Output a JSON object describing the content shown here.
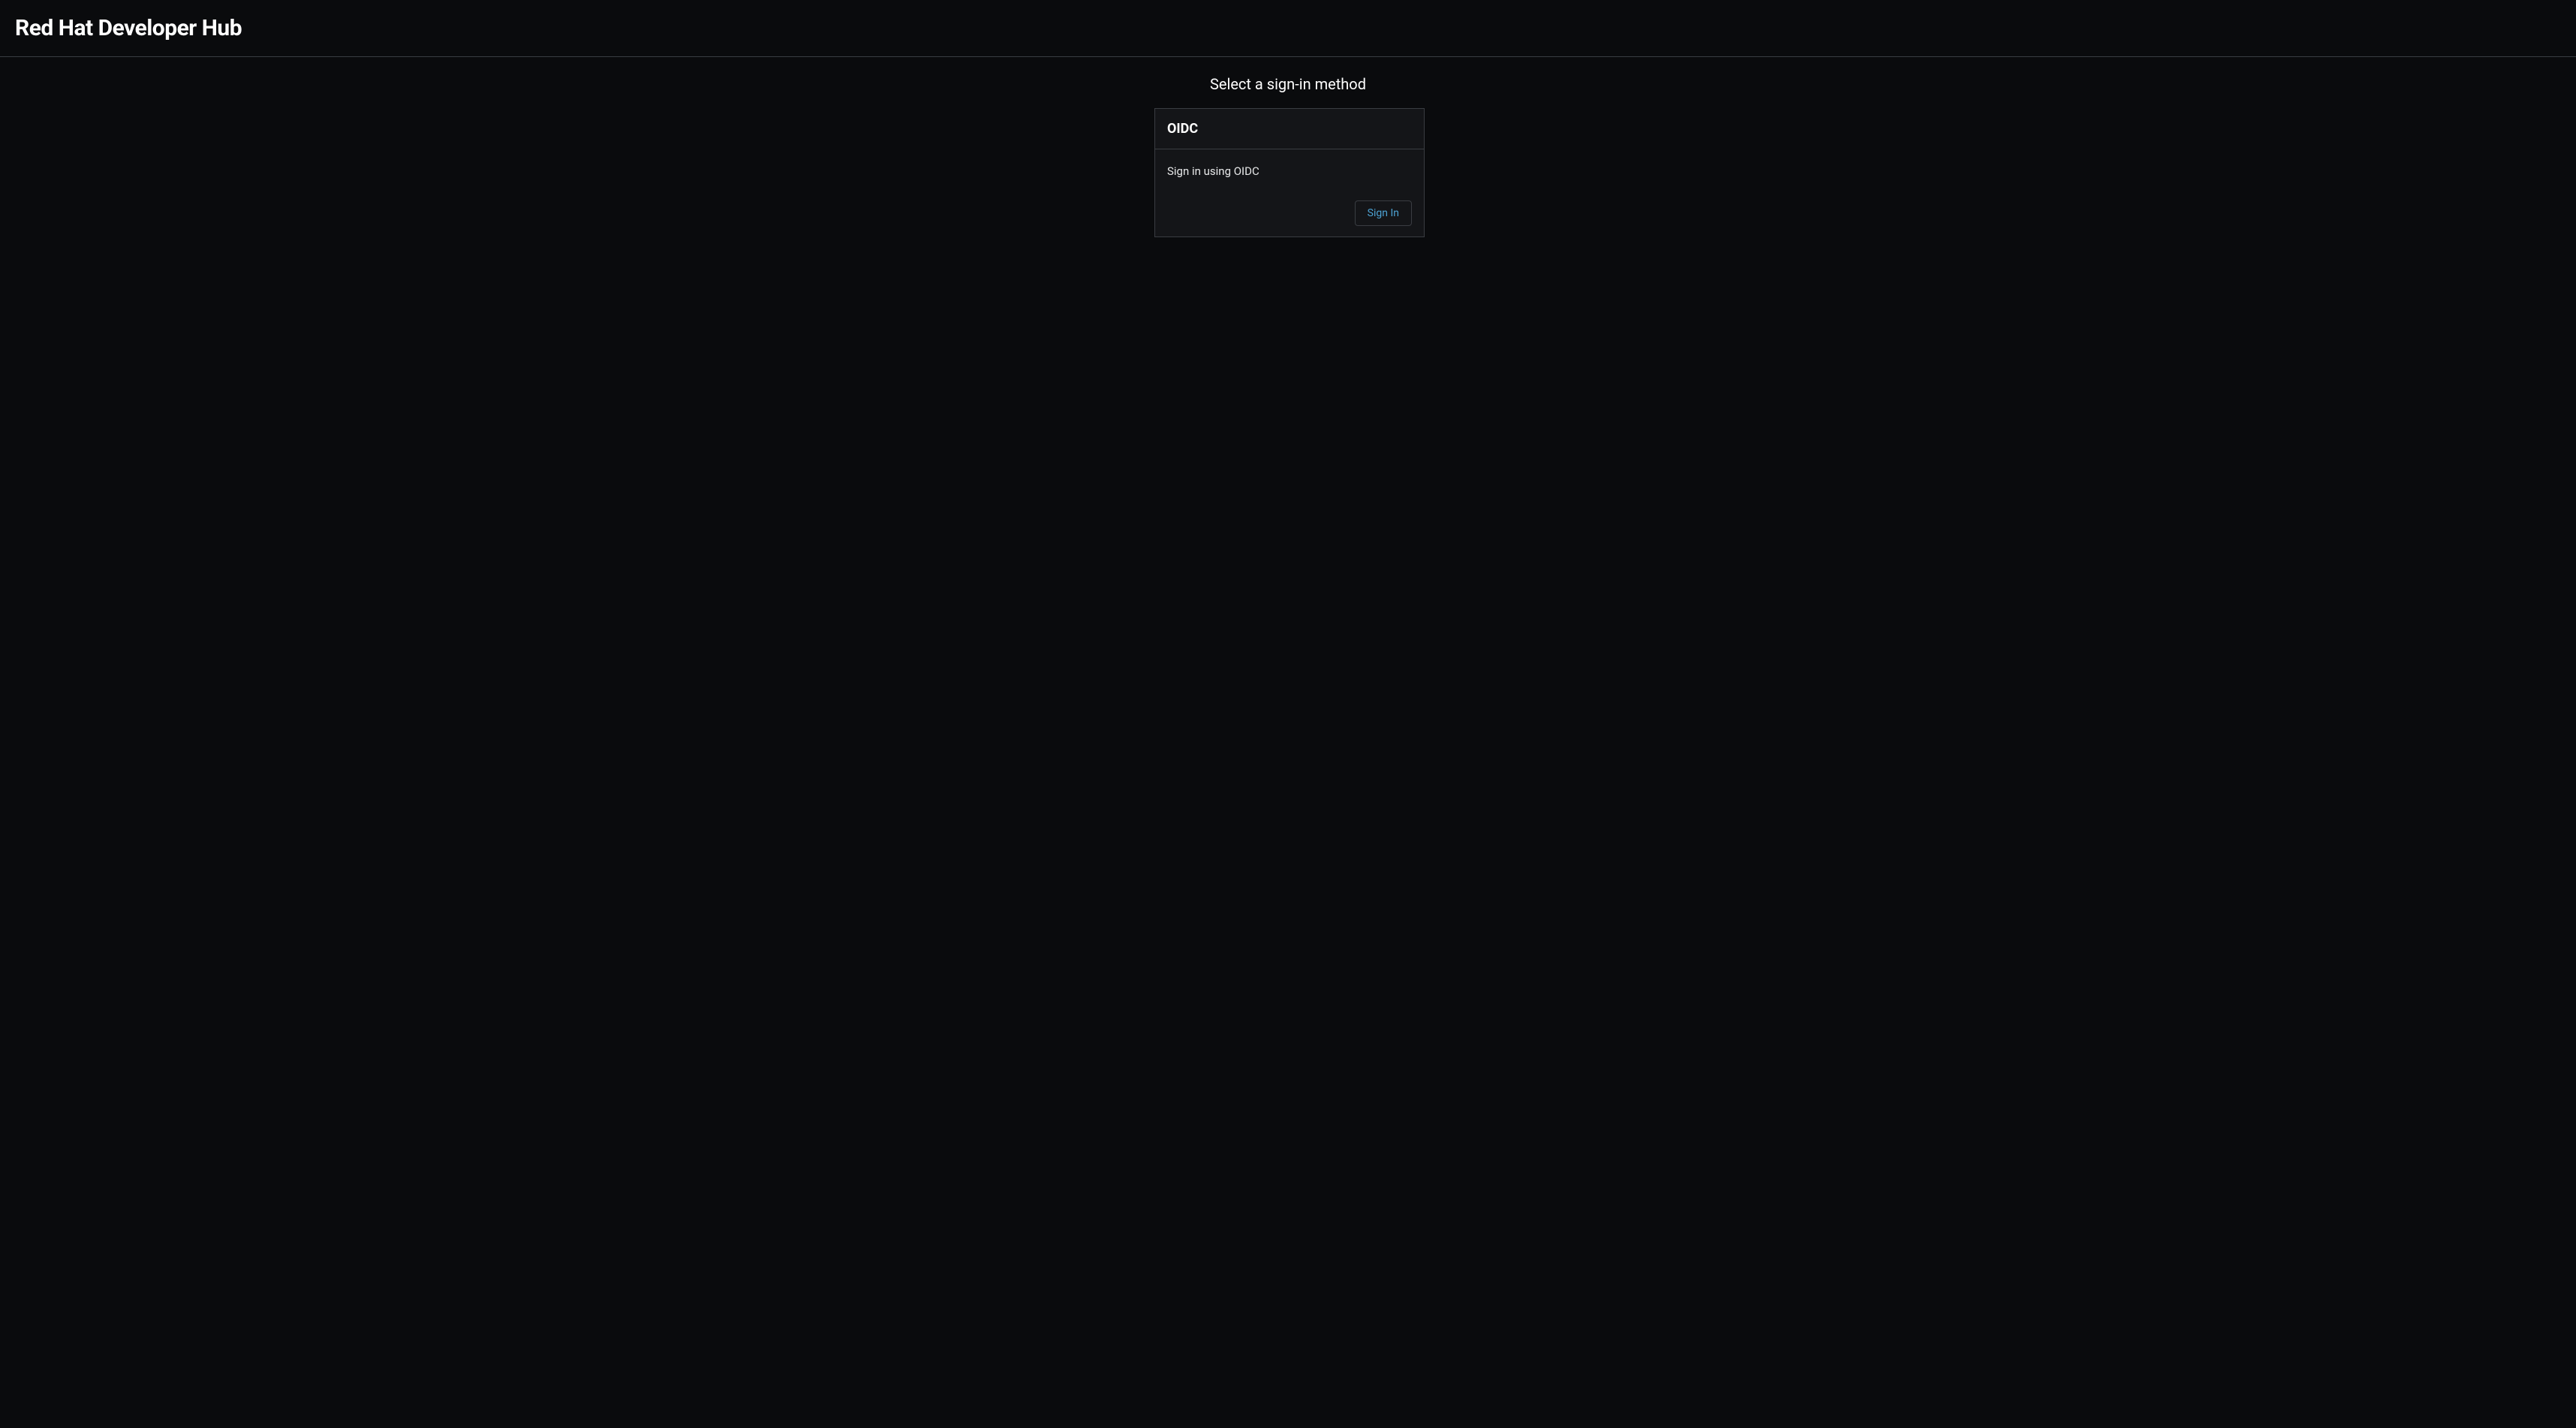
{
  "header": {
    "title": "Red Hat Developer Hub"
  },
  "signin": {
    "prompt": "Select a sign-in method",
    "providers": [
      {
        "name": "OIDC",
        "description": "Sign in using OIDC",
        "button_label": "Sign In"
      }
    ]
  }
}
